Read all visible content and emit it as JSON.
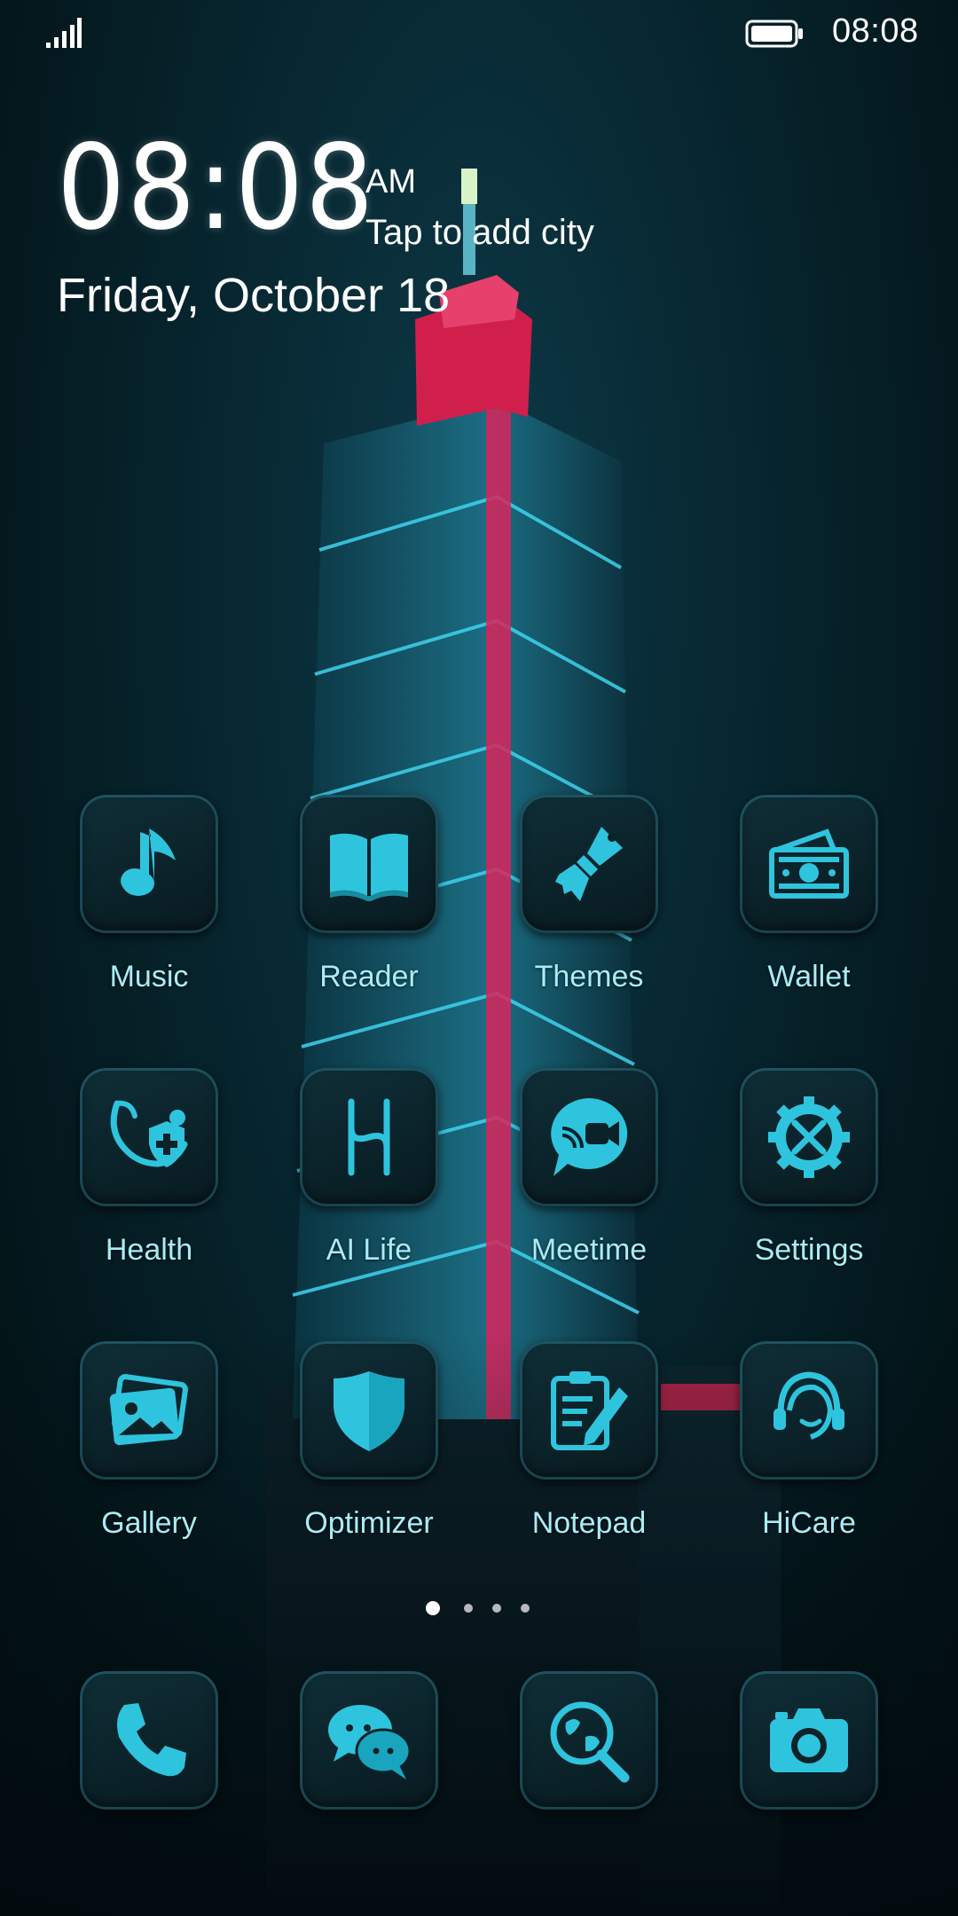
{
  "status_bar": {
    "time": "08:08",
    "signal_icon": "cellular-signal-icon",
    "battery_icon": "battery-full-icon"
  },
  "clock_widget": {
    "time": "08:08",
    "ampm": "AM",
    "city_prompt": "Tap to add city",
    "date": "Friday, October 18"
  },
  "theme": {
    "icon_color": "#2fc4de",
    "label_color": "#a9ecf6",
    "tile_border": "#3ca0b4"
  },
  "apps": [
    {
      "label": "Music",
      "icon": "music-note-icon"
    },
    {
      "label": "Reader",
      "icon": "open-book-icon"
    },
    {
      "label": "Themes",
      "icon": "paintbrush-icon"
    },
    {
      "label": "Wallet",
      "icon": "wallet-cash-icon"
    },
    {
      "label": "Health",
      "icon": "stethoscope-shield-icon"
    },
    {
      "label": "AI Life",
      "icon": "ai-life-logo-icon"
    },
    {
      "label": "Meetime",
      "icon": "video-chat-bubble-icon"
    },
    {
      "label": "Settings",
      "icon": "gear-tools-icon"
    },
    {
      "label": "Gallery",
      "icon": "photo-stack-icon"
    },
    {
      "label": "Optimizer",
      "icon": "shield-icon"
    },
    {
      "label": "Notepad",
      "icon": "clipboard-pencil-icon"
    },
    {
      "label": "HiCare",
      "icon": "headset-person-icon"
    }
  ],
  "page_indicator": {
    "total": 4,
    "current": 1
  },
  "dock": [
    {
      "icon": "phone-icon"
    },
    {
      "icon": "chat-bubbles-icon"
    },
    {
      "icon": "globe-search-icon"
    },
    {
      "icon": "camera-icon"
    }
  ]
}
